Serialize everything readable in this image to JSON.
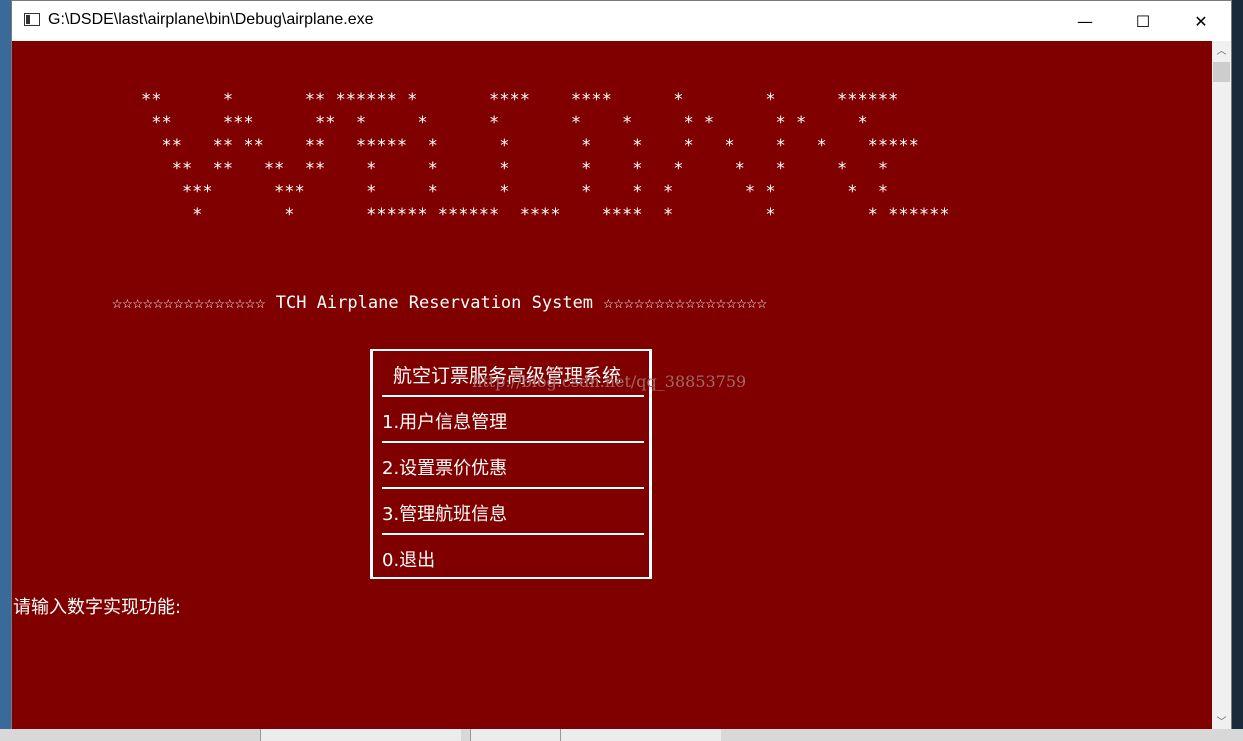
{
  "window": {
    "title": "G:\\DSDE\\last\\airplane\\bin\\Debug\\airplane.exe",
    "controls": {
      "minimize": "—",
      "maximize": "☐",
      "close": "✕"
    }
  },
  "console": {
    "ascii_art": "**      *       ** ****** *       ****    ****      *        *      ******\n **     ***      **  *     *      *       *    *     * *      * *     *\n  **   ** **    **   *****  *      *       *    *    *   *    *   *    *****\n   **  **   **  **    *     *      *       *    *   *     *   *     *   *\n    ***      ***      *     *      *       *    *  *       * *       *  *\n     *        *       ****** ******  ****    ****  *         *         * ******",
    "banner": "☆☆☆☆☆☆☆☆☆☆☆☆☆☆☆ TCH Airplane Reservation System ☆☆☆☆☆☆☆☆☆☆☆☆☆☆☆☆",
    "menu": {
      "title": "航空订票服务高级管理系统",
      "items": [
        {
          "label": "1.用户信息管理"
        },
        {
          "label": "2.设置票价优惠"
        },
        {
          "label": "3.管理航班信息"
        },
        {
          "label": "0.退出"
        }
      ]
    },
    "watermark": "http://blog.csdn.net/qq_38853759",
    "prompt": "请输入数字实现功能:"
  },
  "colors": {
    "console_background": "#800000",
    "console_text": "#ffffff"
  }
}
